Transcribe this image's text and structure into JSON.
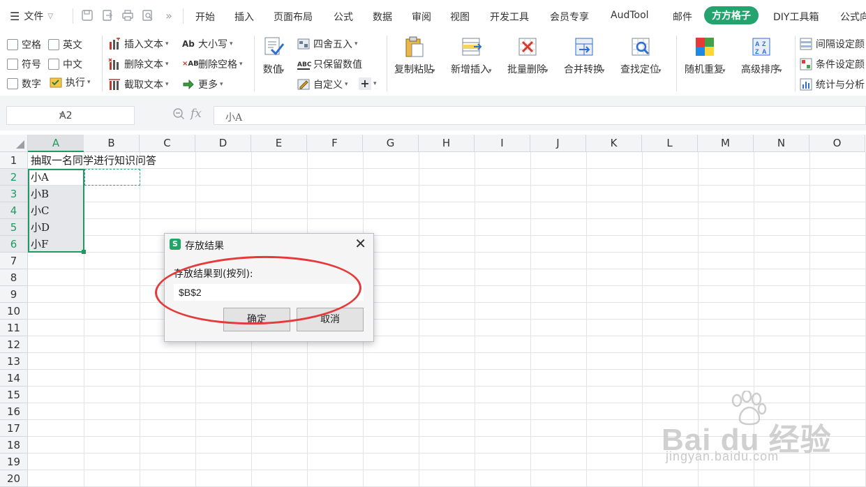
{
  "menu": {
    "file_label": "文件",
    "tabs": [
      "开始",
      "插入",
      "页面布局",
      "公式",
      "数据",
      "审阅",
      "视图",
      "开发工具",
      "会员专享",
      "AudTool",
      "邮件",
      "方方格子",
      "DIY工具箱",
      "公式向"
    ],
    "active_tab": "方方格子"
  },
  "ribbon": {
    "checkboxes": [
      "空格",
      "英文",
      "符号",
      "中文",
      "数字"
    ],
    "execute": "执行",
    "text_tools": [
      "插入文本",
      "删除文本",
      "截取文本"
    ],
    "case_tools": [
      "大小写",
      "删除空格",
      "更多"
    ],
    "number_big": "数值",
    "number_tools": [
      "四舍五入",
      "只保留数值",
      "自定义"
    ],
    "big_buttons": [
      "复制粘贴",
      "新增插入",
      "批量删除",
      "合并转换",
      "查找定位",
      "随机重复",
      "高级排序"
    ],
    "right_tools": [
      "间隔设定颜",
      "条件设定颜",
      "统计与分析"
    ]
  },
  "formula_bar": {
    "name_box": "A2",
    "formula": "小A"
  },
  "sheet": {
    "columns": [
      "A",
      "B",
      "C",
      "D",
      "E",
      "F",
      "G",
      "H",
      "I",
      "J",
      "K",
      "L",
      "M",
      "N",
      "O"
    ],
    "rows": [
      "1",
      "2",
      "3",
      "4",
      "5",
      "6",
      "7",
      "8",
      "9",
      "10",
      "11",
      "12",
      "13",
      "14",
      "15",
      "16",
      "17",
      "18",
      "19",
      "20"
    ],
    "a1": "抽取一名同学进行知识问答",
    "names": [
      "小A",
      "小B",
      "小C",
      "小D",
      "小F"
    ]
  },
  "dialog": {
    "title": "存放结果",
    "label": "存放结果到(按列):",
    "value": "$B$2",
    "ok": "确定",
    "cancel": "取消"
  },
  "watermark": {
    "brand": "Bai du 经验",
    "url": "jingyan.baidu.com"
  },
  "colors": {
    "accent": "#23a36e",
    "selection": "#1f9a63",
    "annotation": "#e5393a"
  }
}
